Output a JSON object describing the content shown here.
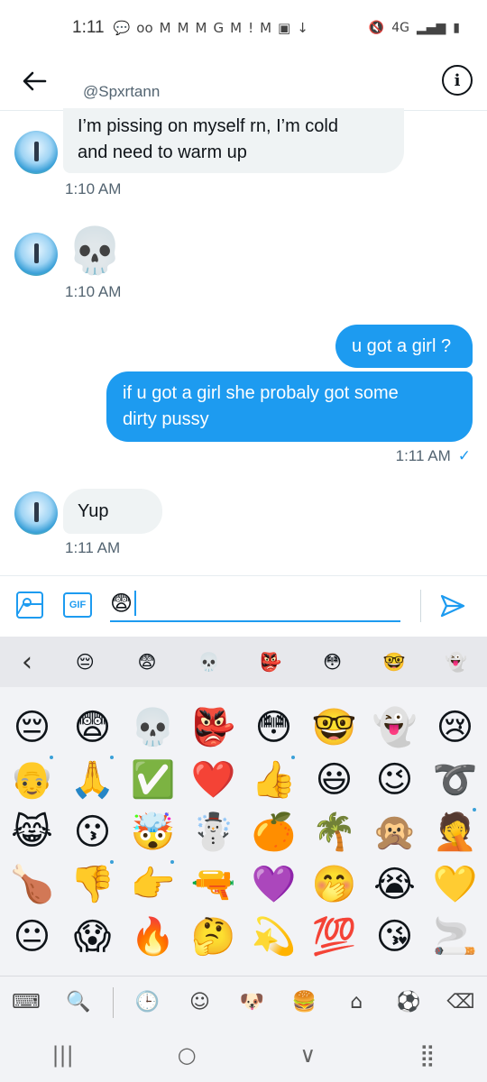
{
  "status_bar": {
    "time": "1:11",
    "left_icons": [
      "💬",
      "oo",
      "M",
      "M",
      "M",
      "G",
      "M",
      "!",
      "M",
      "▣",
      "↓"
    ],
    "right_icons": [
      "🔇",
      "4G",
      "▂▄▆",
      "▮"
    ]
  },
  "header": {
    "handle": "@Spxrtann",
    "back_icon": "arrow-left-icon",
    "info_icon": "info-icon",
    "info_glyph": "i"
  },
  "messages": [
    {
      "direction": "in",
      "lines": [
        "I’m pissing on myself rn, I’m cold",
        "and need to warm up"
      ],
      "time": "1:10 AM"
    },
    {
      "direction": "in",
      "emoji": "💀",
      "time": "1:10 AM"
    },
    {
      "direction": "out",
      "text": "u got a girl ?"
    },
    {
      "direction": "out",
      "lines": [
        "if u got a girl she probaly got some",
        "dirty pussy"
      ],
      "time": "1:11 AM",
      "read_mark": "✓"
    },
    {
      "direction": "in",
      "text": "Yup",
      "time": "1:11 AM"
    }
  ],
  "composer": {
    "gif_label": "GIF",
    "input_value": "😨"
  },
  "keyboard": {
    "recent_back_glyph": "‹",
    "recent": [
      "😔",
      "😨",
      "💀",
      "👺",
      "😳",
      "🤓",
      "👻"
    ],
    "grid": [
      "😔",
      "😨",
      "💀",
      "👺",
      "😳",
      "🤓",
      "👻",
      "😢",
      "👴",
      "🙏",
      "✅",
      "❤️",
      "👍",
      "😃",
      "😉",
      "➰",
      "😹",
      "😗",
      "🤯",
      "☃️",
      "🍊",
      "🌴",
      "🙊",
      "🤦",
      "🍗",
      "👎",
      "👉",
      "🔫",
      "💜",
      "🤭",
      "😭",
      "💛",
      "😐",
      "😱",
      "🔥",
      "🤔",
      "💫",
      "💯",
      "😘",
      "🚬"
    ],
    "bottom_glyphs": [
      "⌨",
      "🔍",
      "🕒",
      "☺",
      "🐶",
      "🍔",
      "⌂",
      "⚽",
      "⌫"
    ],
    "nav_glyphs": [
      "|||",
      "○",
      "∨",
      "⣿"
    ]
  }
}
